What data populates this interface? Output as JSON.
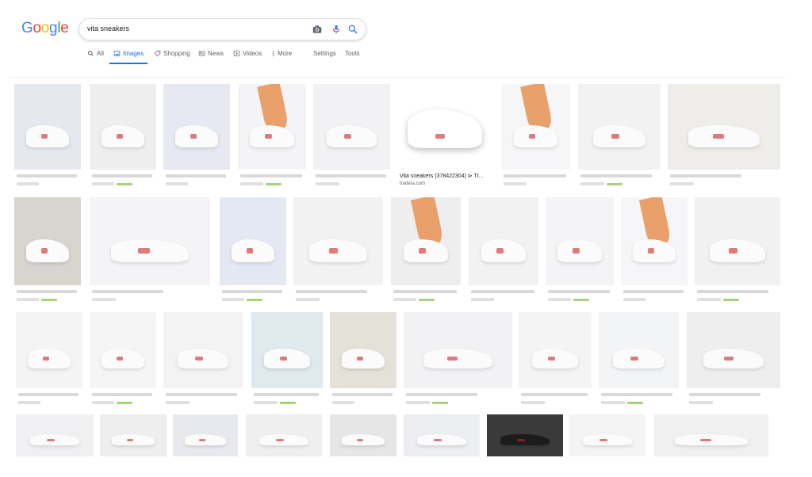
{
  "app": {
    "logo_letters": [
      {
        "char": "G",
        "color": "#4285F4"
      },
      {
        "char": "o",
        "color": "#EA4335"
      },
      {
        "char": "o",
        "color": "#FBBC05"
      },
      {
        "char": "g",
        "color": "#4285F4"
      },
      {
        "char": "l",
        "color": "#34A853"
      },
      {
        "char": "e",
        "color": "#EA4335"
      }
    ]
  },
  "search": {
    "query": "vita sneakers",
    "icons": [
      "camera-icon",
      "microphone-icon",
      "search-icon"
    ]
  },
  "tabs": [
    {
      "label": "All",
      "icon": "search-icon",
      "active": false
    },
    {
      "label": "Images",
      "icon": "image-icon",
      "active": true
    },
    {
      "label": "Shopping",
      "icon": "tag-icon",
      "active": false
    },
    {
      "label": "News",
      "icon": "newspaper-icon",
      "active": false
    },
    {
      "label": "Videos",
      "icon": "play-icon",
      "active": false
    },
    {
      "label": "More",
      "icon": "dots-vertical-icon",
      "active": false
    },
    {
      "label": "Settings",
      "icon": "",
      "active": false
    },
    {
      "label": "Tools",
      "icon": "",
      "active": false
    }
  ],
  "colors": {
    "accent": "#1a73e8",
    "text": "#202124",
    "muted": "#5f6368"
  },
  "results": {
    "featured": {
      "caption": "Vita sneakers (378422304) ⊳ Tr...",
      "source": "tradera.com"
    }
  }
}
